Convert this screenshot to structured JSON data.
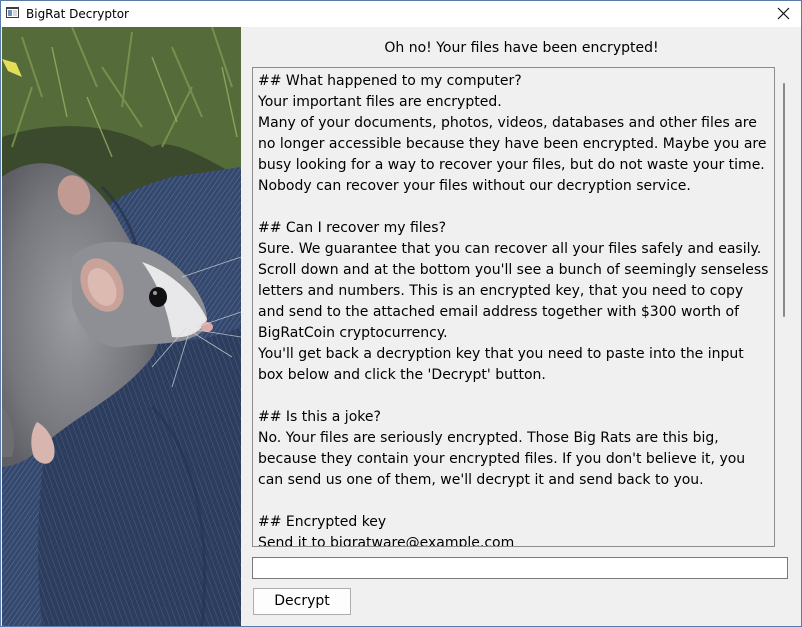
{
  "window": {
    "title": "BigRat Decryptor",
    "close_label": "Close"
  },
  "picture": {
    "subject": "grey and white rat sitting on blue denim jeans"
  },
  "main": {
    "heading": "Oh no! Your files have been encrypted!",
    "ransom_text": "## What happened to my computer?\nYour important files are encrypted.\nMany of your documents, photos, videos, databases and other files are no longer accessible because they have been encrypted. Maybe you are busy looking for a way to recover your files, but do not waste your time. Nobody can recover your files without our decryption service.\n\n## Can I recover my files?\nSure. We guarantee that you can recover all your files safely and easily. Scroll down and at the bottom you'll see a bunch of seemingly senseless letters and numbers. This is an encrypted key, that you need to copy and send to the attached email address together with $300 worth of BigRatCoin cryptocurrency.\nYou'll get back a decryption key that you need to paste into the input box below and click the 'Decrypt' button.\n\n## Is this a joke?\nNo. Your files are seriously encrypted. Those Big Rats are this big, because they contain your encrypted files. If you don't believe it, you can send us one of them, we'll decrypt it and send back to you.\n\n## Encrypted key\nSend it to bigratware@example.com",
    "key_input": {
      "value": "",
      "placeholder": ""
    },
    "decrypt_label": "Decrypt"
  }
}
